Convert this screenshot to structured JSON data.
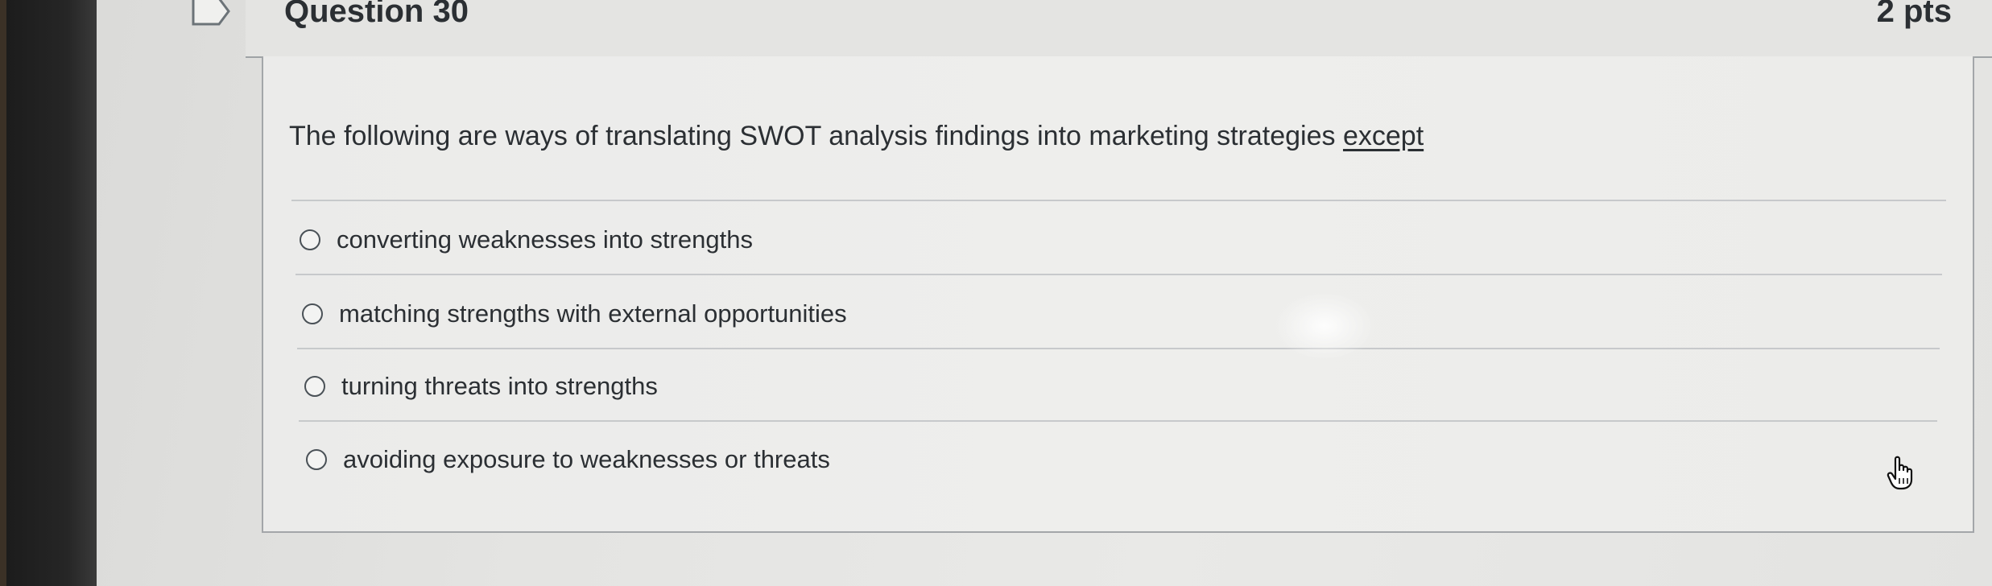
{
  "question": {
    "title": "Question 30",
    "points": "2 pts",
    "prompt": "The following are ways of translating SWOT analysis findings into marketing strategies ",
    "prompt_emphasis": "except",
    "answers": [
      {
        "label": "converting weaknesses into strengths",
        "selected": false
      },
      {
        "label": "matching strengths with external opportunities",
        "selected": false
      },
      {
        "label": "turning threats into strengths",
        "selected": false
      },
      {
        "label": "avoiding exposure to weaknesses or threats",
        "selected": false
      }
    ]
  },
  "icons": {
    "flag": "flag-icon",
    "radio": "radio-button",
    "cursor": "hand-pointer-icon"
  },
  "colors": {
    "text": "#2b2f33",
    "border": "#a3a6a9",
    "header_bg": "#e4e4e2"
  }
}
